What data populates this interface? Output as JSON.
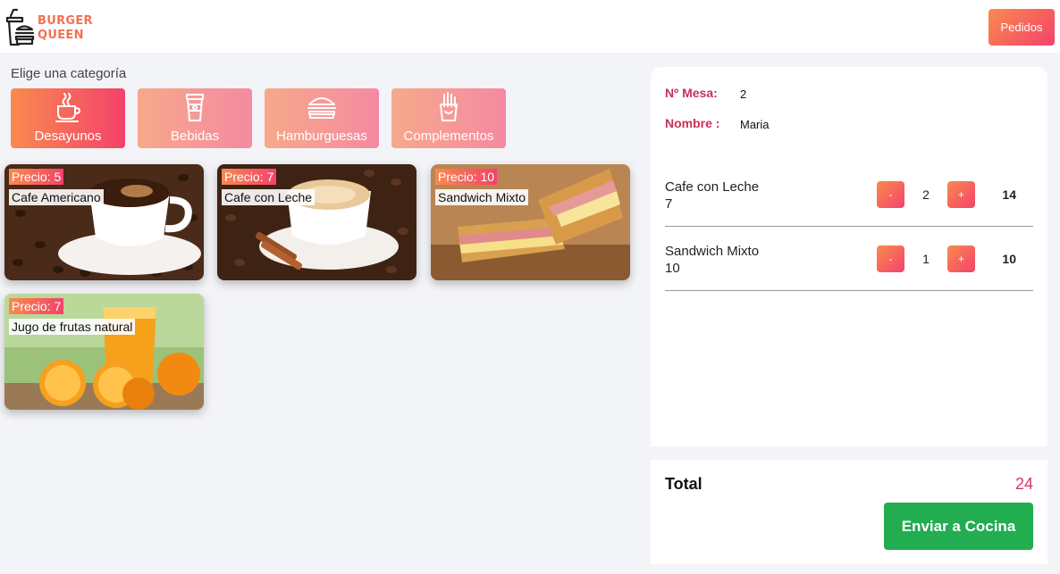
{
  "header": {
    "brand_line1": "BURGER",
    "brand_line2": "QUEEN",
    "logo_icon": "drink-burger-icon",
    "pedidos_label": "Pedidos",
    "brand_color": "#f4714f"
  },
  "menu": {
    "title": "Elige una categoría",
    "categories": [
      {
        "label": "Desayunos",
        "icon": "coffee-cup-icon",
        "active": true
      },
      {
        "label": "Bebidas",
        "icon": "drink-cup-icon",
        "active": false
      },
      {
        "label": "Hamburguesas",
        "icon": "burger-icon",
        "active": false
      },
      {
        "label": "Complementos",
        "icon": "fries-icon",
        "active": false
      }
    ],
    "products": [
      {
        "price": "Precio: 5",
        "name": "Cafe Americano"
      },
      {
        "price": "Precio: 7",
        "name": "Cafe con Leche"
      },
      {
        "price": "Precio: 10",
        "name": "Sandwich Mixto"
      },
      {
        "price": "Precio: 7",
        "name": "Jugo de frutas natural"
      }
    ]
  },
  "order": {
    "mesa_label": "Nº Mesa:",
    "mesa_value": "2",
    "nombre_label": "Nombre :",
    "nombre_value": "Maria",
    "items": [
      {
        "name": "Cafe con Leche",
        "price": "7",
        "qty": "2",
        "subtotal": "14",
        "minus": "-",
        "plus": "+"
      },
      {
        "name": "Sandwich Mixto",
        "price": "10",
        "qty": "1",
        "subtotal": "10",
        "minus": "-",
        "plus": "+"
      }
    ],
    "total_label": "Total",
    "total_value": "24",
    "send_label": "Enviar a Cocina"
  },
  "colors": {
    "gradient_start": "#f98a4e",
    "gradient_end": "#f4426b",
    "accent_pink": "#d6336c",
    "send_green": "#21ad50"
  }
}
